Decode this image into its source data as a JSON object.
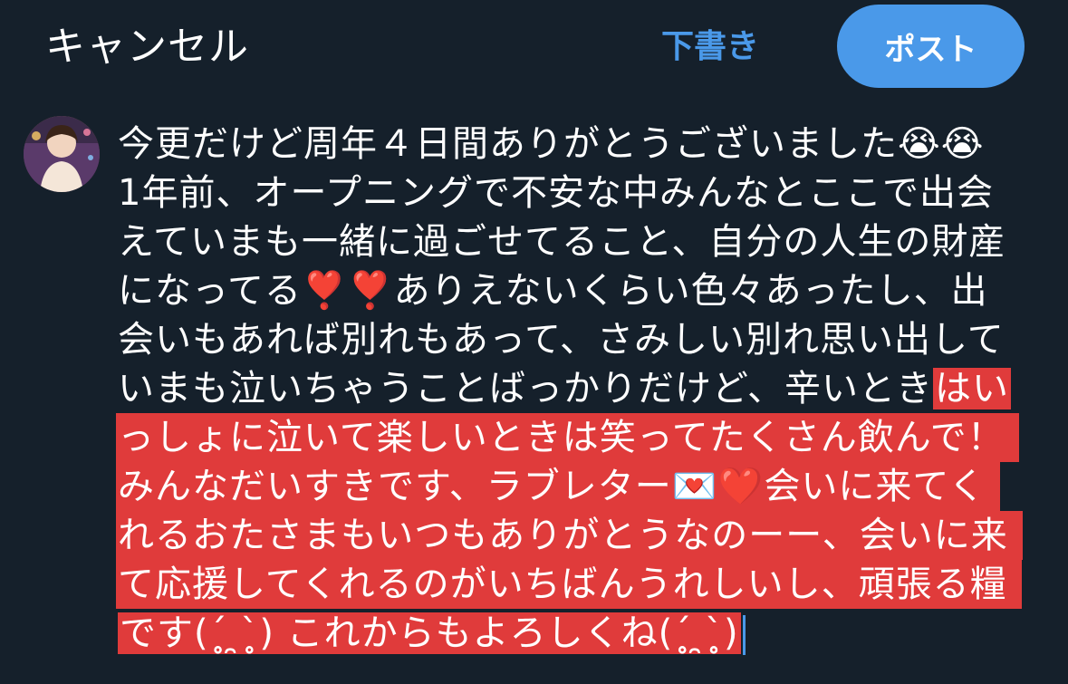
{
  "topbar": {
    "cancel_label": "キャンセル",
    "draft_label": "下書き",
    "post_label": "ポスト"
  },
  "composer": {
    "lines": [
      {
        "text": "今更だけど周年４日間ありがとうございました😭😭",
        "highlight": ""
      },
      {
        "text": "1年前、オープニングで不安な中みんなとここで出会",
        "highlight": ""
      },
      {
        "text": "えていまも一緒に過ごせてること、自分の人生の財産",
        "highlight": ""
      },
      {
        "text": "になってる❣️❣️ありえないくらい色々あったし、出",
        "highlight": ""
      },
      {
        "text": "会いもあれば別れもあって、さみしい別れ思い出して",
        "highlight": ""
      },
      {
        "text": "いまも泣いちゃうことばっかりだけど、辛いとき",
        "highlight": "はい"
      },
      {
        "text": "",
        "highlight": "っしょに泣いて楽しいときは笑ってたくさん飲んで！"
      },
      {
        "text": "",
        "highlight": "みんなだいすきです、ラブレター💌❤️会いに来てく"
      },
      {
        "text": "",
        "highlight": "れるおたさまもいつもありがとうなのーー、会いに来"
      },
      {
        "text": "",
        "highlight": "て応援してくれるのがいちばんうれしいし、頑張る糧"
      },
      {
        "text": "",
        "highlight": "です(ˊ̥̥ ̯ˋ̥̥) これからもよろしくね(ˊ̥̥ ̯ˋ̥̥)"
      }
    ]
  },
  "colors": {
    "background": "#15202b",
    "accent": "#4a99e9",
    "highlight": "#e03b3b",
    "text": "#ffffff"
  }
}
